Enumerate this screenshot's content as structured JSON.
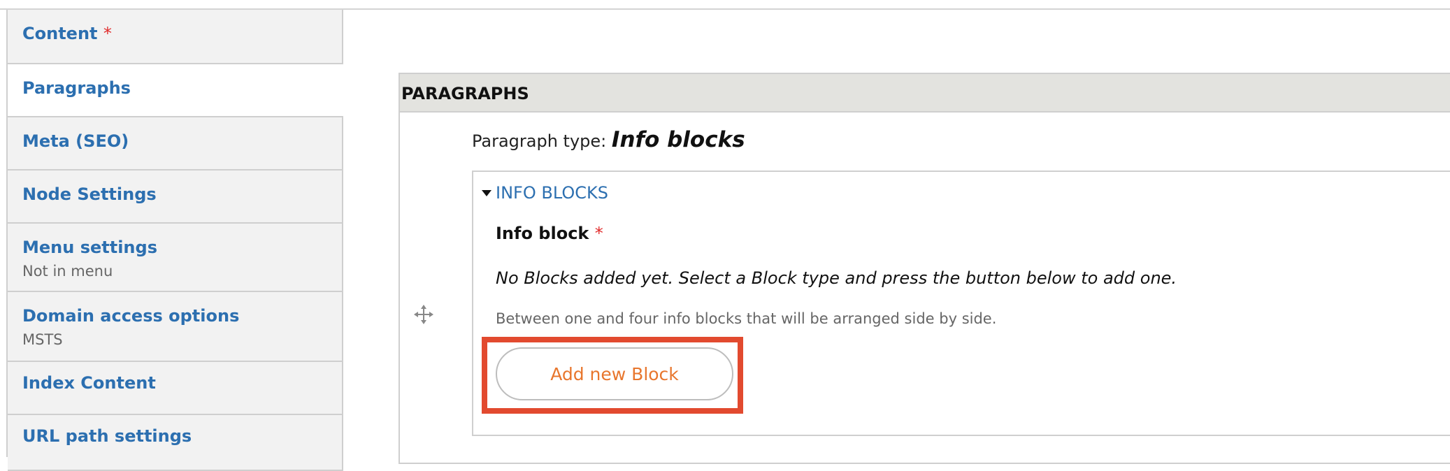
{
  "sidebar": {
    "tabs": [
      {
        "label": "Content",
        "required": "*",
        "summary": ""
      },
      {
        "label": "Paragraphs",
        "summary": ""
      },
      {
        "label": "Meta (SEO)",
        "summary": ""
      },
      {
        "label": "Node Settings",
        "summary": ""
      },
      {
        "label": "Menu settings",
        "summary": "Not in menu"
      },
      {
        "label": "Domain access options",
        "summary": "MSTS"
      },
      {
        "label": "Index Content",
        "summary": ""
      },
      {
        "label": "URL path settings",
        "summary": ""
      }
    ],
    "selected": "Paragraphs"
  },
  "main": {
    "section_title": "PARAGRAPHS",
    "paragraph_type_label": "Paragraph type:",
    "paragraph_type_value": "Info blocks",
    "drag_icon": "move-handle-icon",
    "info_blocks": {
      "summary": "INFO BLOCKS",
      "field_label": "Info block",
      "required_marker": "*",
      "empty_message": "No Blocks added yet. Select a Block type and press the button below to add one.",
      "description": "Between one and four info blocks that will be arranged side by side.",
      "add_button": "Add new Block"
    }
  },
  "colors": {
    "link": "#2c6fb0",
    "required": "#e12c2c",
    "button_text": "#e8762d",
    "highlight": "#e24a2f"
  }
}
